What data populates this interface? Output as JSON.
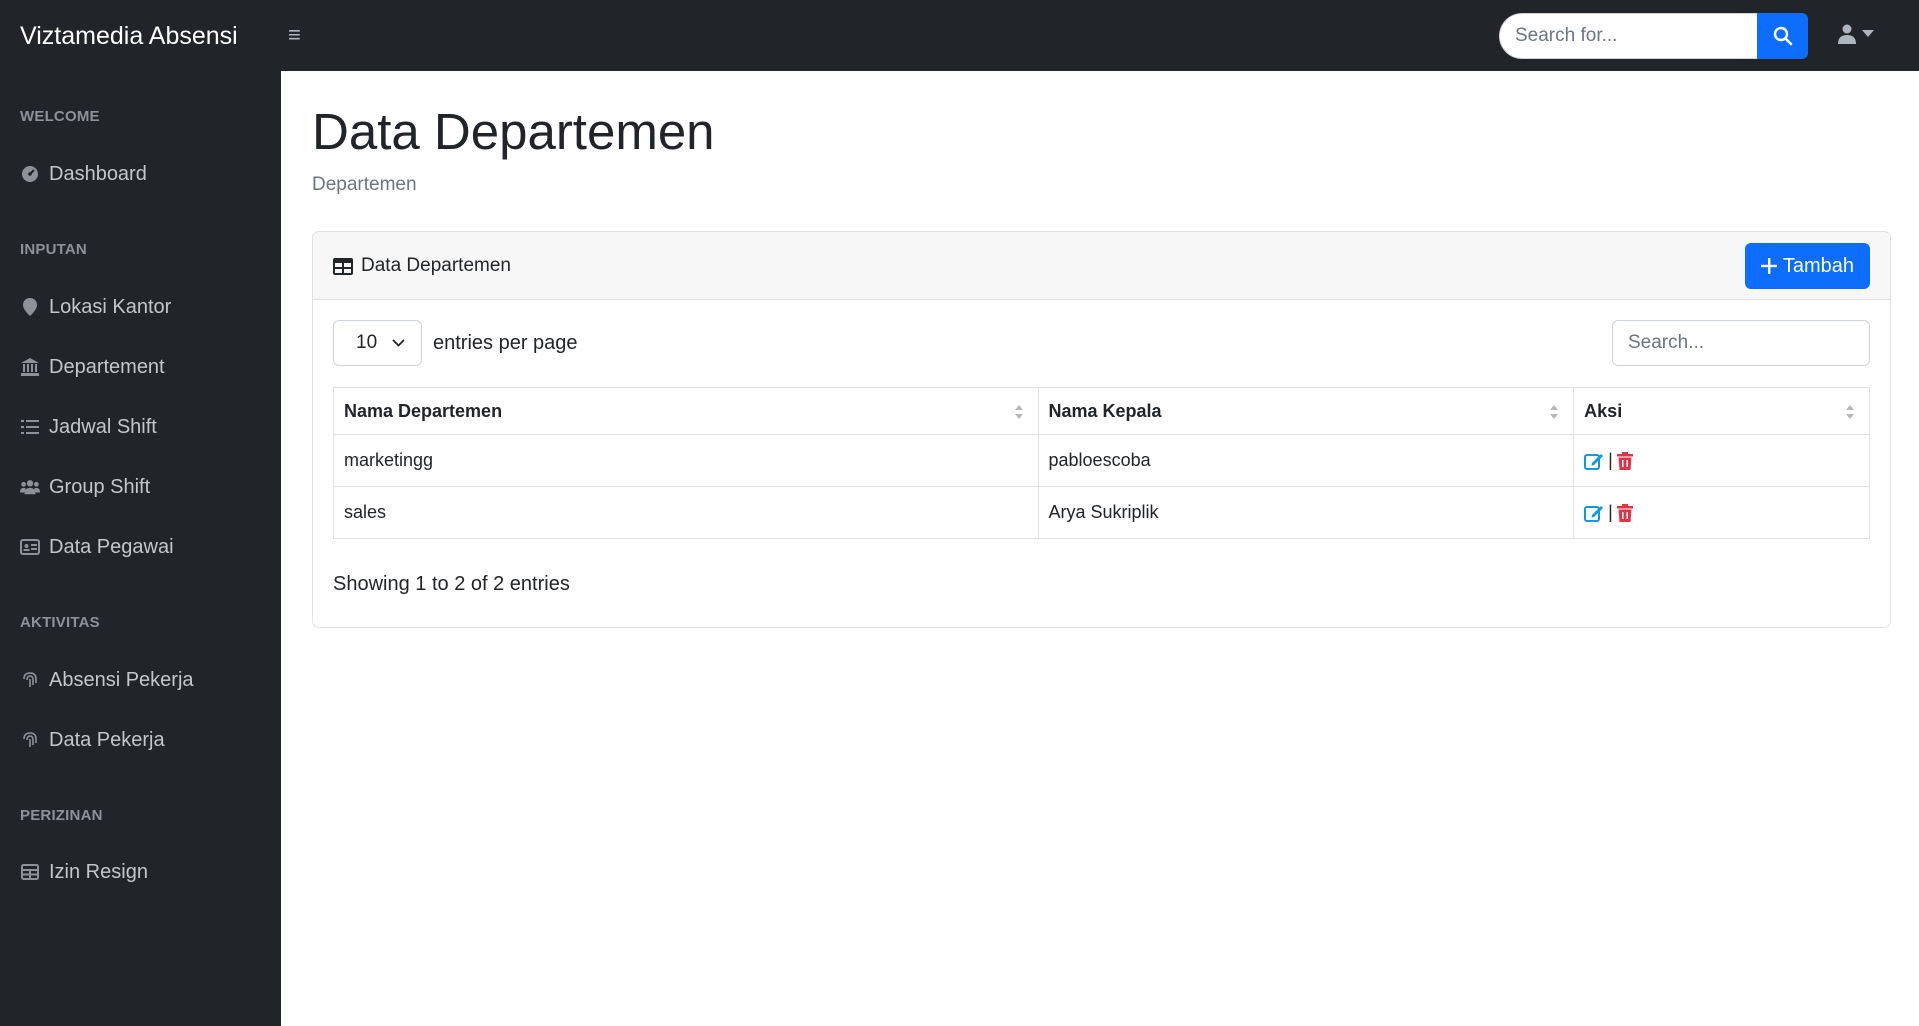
{
  "app": {
    "brand": "Viztamedia Absensi"
  },
  "topbar": {
    "search_placeholder": "Search for...",
    "search_icon": "search-icon",
    "user_icon": "user-icon"
  },
  "sidebar": {
    "sections": [
      {
        "heading": "WELCOME",
        "items": [
          {
            "label": "Dashboard",
            "icon": "dashboard-icon"
          }
        ]
      },
      {
        "heading": "INPUTAN",
        "items": [
          {
            "label": "Lokasi Kantor",
            "icon": "map-pin-icon"
          },
          {
            "label": "Departement",
            "icon": "bank-icon"
          },
          {
            "label": "Jadwal Shift",
            "icon": "list-icon"
          },
          {
            "label": "Group Shift",
            "icon": "users-icon"
          },
          {
            "label": "Data Pegawai",
            "icon": "id-card-icon"
          }
        ]
      },
      {
        "heading": "AKTIVITAS",
        "items": [
          {
            "label": "Absensi Pekerja",
            "icon": "fingerprint-icon"
          },
          {
            "label": "Data Pekerja",
            "icon": "fingerprint-icon"
          }
        ]
      },
      {
        "heading": "PERIZINAN",
        "items": [
          {
            "label": "Izin Resign",
            "icon": "table-icon"
          }
        ]
      }
    ]
  },
  "page": {
    "title": "Data Departemen",
    "breadcrumb": "Departemen"
  },
  "card": {
    "title": "Data Departemen",
    "add_button": "Tambah",
    "page_length": "10",
    "page_length_label": "entries per page",
    "search_placeholder": "Search...",
    "columns": [
      "Nama Departemen",
      "Nama Kepala",
      "Aksi"
    ],
    "rows": [
      {
        "nama_departemen": "marketingg",
        "nama_kepala": "pabloescoba",
        "separator": "|"
      },
      {
        "nama_departemen": "sales",
        "nama_kepala": "Arya Sukriplik",
        "separator": "|"
      }
    ],
    "info": "Showing 1 to 2 of 2 entries"
  },
  "colors": {
    "accent": "#0d6efd",
    "sidebar_bg": "#212529",
    "danger": "#dc3545",
    "edit": "#0d99e0"
  }
}
